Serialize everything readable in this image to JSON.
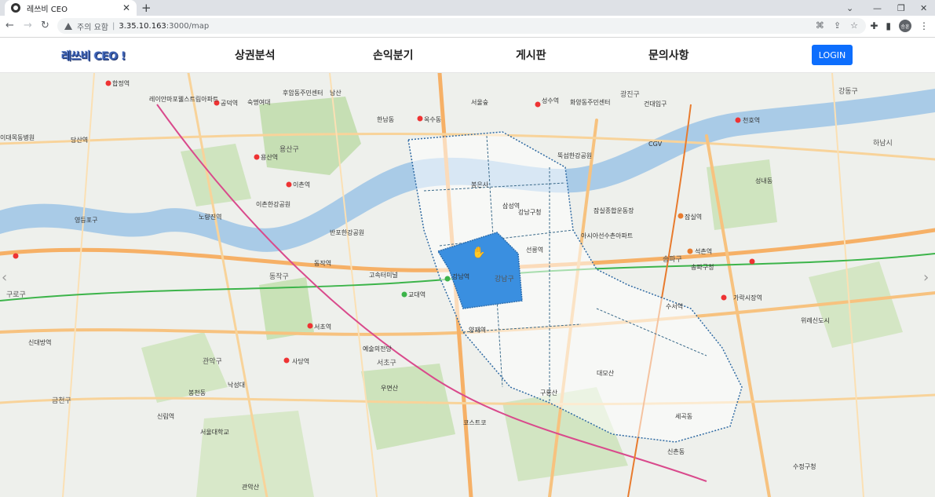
{
  "browser": {
    "tab_title": "레쓰비 CEO",
    "close_glyph": "✕",
    "new_tab_glyph": "+",
    "security_label": "주의 요함",
    "url_host": "3.35.10.163",
    "url_path": ":3000/map",
    "avatar_text": "승훈"
  },
  "site": {
    "logo": "레쓰비 CEO !",
    "nav": [
      "상권분석",
      "손익분기",
      "게시판",
      "문의사항"
    ],
    "login_label": "LOGIN",
    "accent": "#0d6efd"
  },
  "map": {
    "selected_fill": "#3a8fe0",
    "labels": {
      "l1": "합정역",
      "l2": "레이안마포웰스트림아파트",
      "l3": "공덕역",
      "l4": "후암동주민센터",
      "l5": "남산",
      "l6": "용산구",
      "l7": "용산역",
      "l8": "이촌역",
      "l9": "이촌한강공원",
      "l10": "반포한강공원",
      "l11": "동작역",
      "l12": "동작구",
      "l13": "노량진역",
      "l14": "신대방역",
      "l15": "서초구",
      "l16": "고속터미널",
      "l17": "교대역",
      "l18": "서초역",
      "l19": "강남역",
      "l20": "강남구",
      "l21": "양재역",
      "l22": "구룡산",
      "l23": "대모산",
      "l24": "송파구",
      "l25": "잠실역",
      "l26": "석촌역",
      "l27": "강동구",
      "l28": "성내동",
      "l29": "가락시장역",
      "l30": "수서역",
      "l31": "우면산",
      "l32": "관악구",
      "l33": "관악산",
      "l34": "금천구",
      "l35": "구로구",
      "l36": "영등포구",
      "l37": "당산역",
      "l38": "이대목동병원",
      "l39": "성수역",
      "l40": "화양동주민센터",
      "l41": "광진구",
      "l42": "건대입구",
      "l43": "천호역",
      "l44": "하남시",
      "l45": "선릉역",
      "l46": "삼성역",
      "l47": "봉은사",
      "l48": "CGV",
      "l49": "숙명여대",
      "l50": "한남동",
      "l51": "옥수동",
      "l52": "서울숲",
      "l53": "뚝섬한강공원",
      "l54": "잠실종합운동장",
      "l55": "아시아선수촌아파트",
      "l56": "송파구청",
      "l57": "위례신도시",
      "l58": "수정구청",
      "l59": "사당역",
      "l60": "낙성대",
      "l61": "신림역",
      "l62": "봉천동",
      "l63": "예술의전당",
      "l64": "코스트코",
      "l65": "세곡동",
      "l66": "신촌동",
      "l67": "서울대학교",
      "l68": "강남구청"
    }
  }
}
